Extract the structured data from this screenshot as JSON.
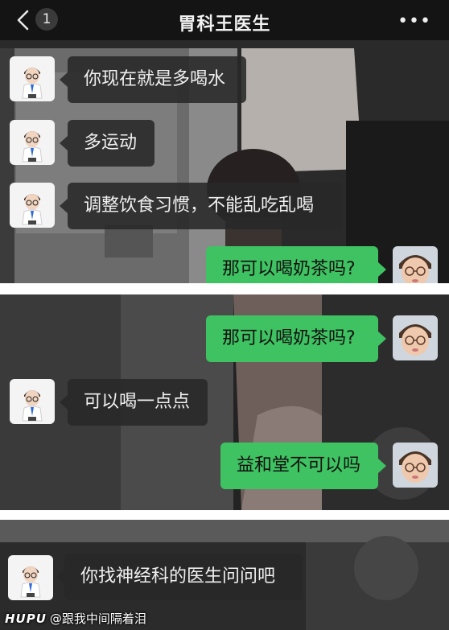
{
  "header": {
    "back_count": "1",
    "title": "胃科王医生",
    "more": "•••"
  },
  "messages": {
    "p1_m1": "你现在就是多喝水",
    "p1_m2": "多运动",
    "p1_m3": "调整饮食习惯，不能乱吃乱喝",
    "p1_m4": "那可以喝奶茶吗?",
    "p2_m1": "那可以喝奶茶吗?",
    "p2_m2": "可以喝一点点",
    "p2_m3": "益和堂不可以吗",
    "p3_m1": "你找神经科的医生问问吧"
  },
  "watermark": {
    "brand": "HUPU",
    "handle": "@跟我中间隔着泪"
  },
  "colors": {
    "out_bubble": "#3fc262",
    "in_bubble": "#282828",
    "header": "#141414"
  },
  "icons": [
    "back-icon",
    "more-icon",
    "doctor-avatar",
    "child-avatar"
  ]
}
